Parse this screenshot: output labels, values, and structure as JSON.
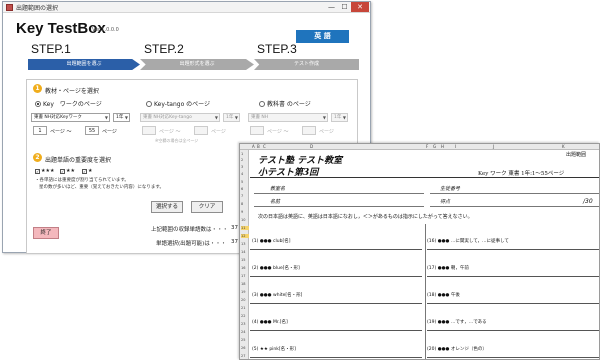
{
  "dialog": {
    "window_title": "出題範囲の選択",
    "app_name": "Key TestBox",
    "version": "Ver.1.0.0.0",
    "subject_badge": "英 語",
    "steps": [
      {
        "title": "STEP.1",
        "label": "出題範囲を選ぶ",
        "state": "active"
      },
      {
        "title": "STEP.2",
        "label": "出題形式を選ぶ",
        "state": "inactive"
      },
      {
        "title": "STEP.3",
        "label": "テスト作成",
        "state": "inactive"
      }
    ],
    "section1": {
      "number": "1",
      "label": "教材・ページを選択",
      "radios": [
        {
          "label": "Key　ワークのページ",
          "selected": true
        },
        {
          "label": "Key-tango のページ",
          "selected": false
        },
        {
          "label": "教科書 のページ",
          "selected": false
        }
      ],
      "key_work": {
        "select": "東書 NH対応Keyワーク",
        "grade": "1年",
        "page_from": "1",
        "page_sep": "ページ ～",
        "page_to": "55",
        "page_unit": "ページ"
      },
      "key_tango": {
        "select": "東書 NH対応Key-tango",
        "grade": "1年",
        "page_sep": "ページ ～",
        "page_unit": "ページ",
        "note": "※空欄の場合は全ページ"
      },
      "textbook": {
        "select": "東書 NH",
        "grade": "1年",
        "page_sep": "ページ ～",
        "page_unit": "ページ"
      }
    },
    "section2": {
      "number": "2",
      "label": "出題単語の重要度を選択",
      "checks": [
        {
          "label": "★★★",
          "checked": true
        },
        {
          "label": "★★",
          "checked": true
        },
        {
          "label": "★",
          "checked": true
        }
      ],
      "notes": [
        "・各単語には重要度が割り当てられています。",
        "星の数が多いほど、重要（覚えておきたい内容）になります。"
      ],
      "select_button": "選択する",
      "clear_button": "クリア"
    },
    "end_button": "終了",
    "summary": [
      {
        "label": "上記範囲の収録単語数は・・・",
        "value": "37",
        "unit": "語"
      },
      {
        "label": "単語選択(出題可能)は・・・",
        "value": "37",
        "unit": "語"
      }
    ]
  },
  "sheet": {
    "column_headers": [
      "A",
      "B",
      "C",
      "D",
      "F",
      "G",
      "H",
      "I",
      "J",
      "K"
    ],
    "row_numbers": [
      "1",
      "2",
      "3",
      "4",
      "5",
      "6",
      "7",
      "8",
      "9",
      "10",
      "11",
      "12",
      "13",
      "14",
      "15",
      "16",
      "17",
      "18",
      "19",
      "20",
      "21",
      "22",
      "23",
      "24",
      "25",
      "26",
      "27",
      "28",
      "29",
      "30",
      "31",
      "32"
    ],
    "range_label": "出題範囲",
    "heading": "テスト塾 テスト教室",
    "subheading": "小テスト第3回",
    "workbook_info": "Key ワーク 東書 1年:1～55ページ",
    "labels": {
      "class": "教室名",
      "name": "名前",
      "student_no": "生徒番号",
      "score": "得点",
      "score_total": "/30"
    },
    "instruction": "次の日本語は英語に、英語は日本語になおし，＜＞があるものは指示にしたがって答えなさい。",
    "questions": [
      {
        "no": "(1)",
        "stars": "●●●",
        "text": "club[名]"
      },
      {
        "no": "(16)",
        "stars": "●●●",
        "text": "…に関実して，…に従事して"
      },
      {
        "no": "(2)",
        "stars": "●●●",
        "text": "blue[名・形]"
      },
      {
        "no": "(17)",
        "stars": "●●●",
        "text": "朝，午前"
      },
      {
        "no": "(3)",
        "stars": "●●●",
        "text": "white[名・形]"
      },
      {
        "no": "(18)",
        "stars": "●●●",
        "text": "午後"
      },
      {
        "no": "(4)",
        "stars": "●●●",
        "text": "Mr.[名]"
      },
      {
        "no": "(19)",
        "stars": "●●●",
        "text": "…です，…である"
      },
      {
        "no": "(5)",
        "stars": "★★",
        "text": "pink[名・形]"
      },
      {
        "no": "(20)",
        "stars": "●●●",
        "text": "オレンジ（色の）"
      }
    ]
  }
}
